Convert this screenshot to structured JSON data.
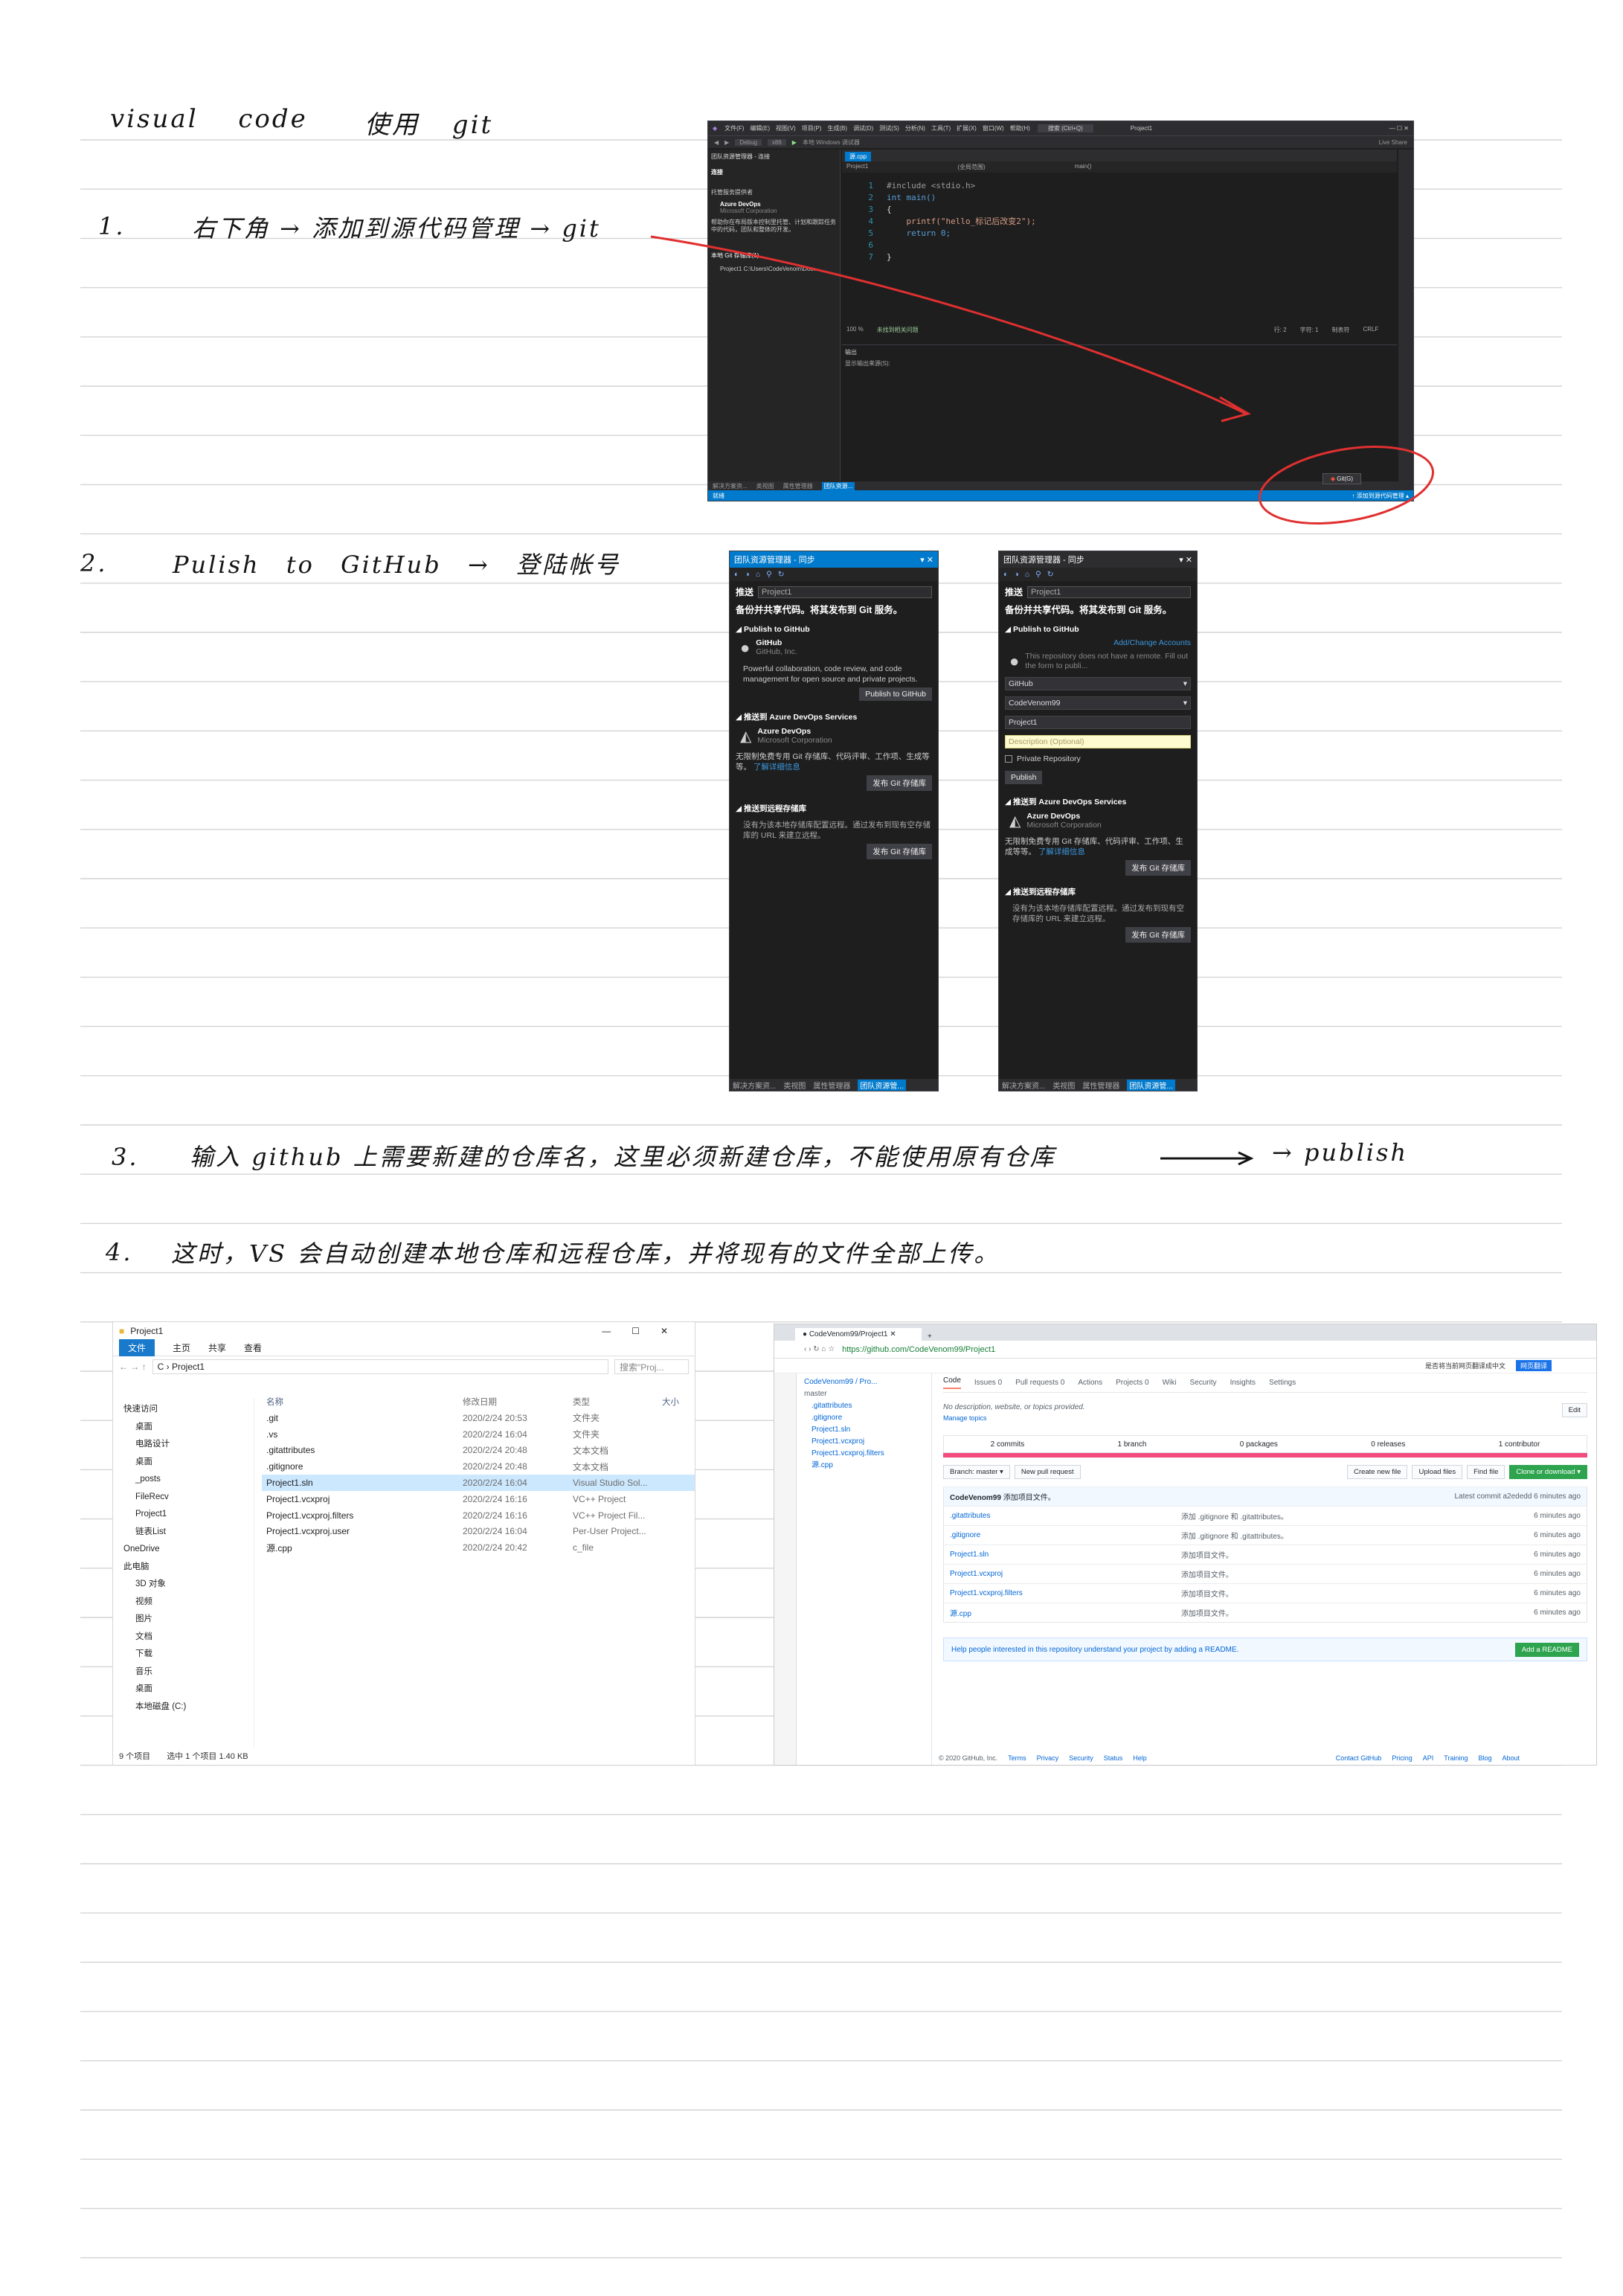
{
  "notes": {
    "title": {
      "left": "visual code",
      "right": "使用 git"
    },
    "step1": {
      "num": "1.",
      "text": "右下角 → 添加到源代码管理 → git"
    },
    "step2": {
      "num": "2.",
      "text": "Pulish to GitHub → 登陆帐号"
    },
    "step3": {
      "num": "3.",
      "text": "输入 github 上需要新建的仓库名，这里必须新建仓库，不能使用原有仓库",
      "arrow_target": "→ publish"
    },
    "step4": {
      "num": "4.",
      "text": "这时，VS 会自动创建本地仓库和远程仓库，并将现有的文件全部上传。"
    }
  },
  "vs": {
    "title": "Project1",
    "menu": [
      "文件(F)",
      "编辑(E)",
      "视图(V)",
      "项目(P)",
      "生成(B)",
      "调试(D)",
      "测试(S)",
      "分析(N)",
      "工具(T)",
      "扩展(X)",
      "窗口(W)",
      "帮助(H)"
    ],
    "search_placeholder": "搜索 (Ctrl+Q)",
    "config": "Debug",
    "platform": "x86",
    "debugger": "本地 Windows 调试器",
    "live_share": "Live Share",
    "left_title": "团队资源管理器 - 连接",
    "left_connect": "连接",
    "left_hosting": "托管服务提供者",
    "left_provider": "Azure DevOps",
    "left_provider_co": "Microsoft Corporation",
    "left_desc": "帮助你在布局版本控制里托管、计划和跟踪任务中的代码，团队和整体的开发。",
    "left_local_repos": "本地 Git 存储库(1)",
    "left_repo": "Project1  C:\\Users\\CodeVenom\\Doc...",
    "tab_file": "源.cpp",
    "breadcrumb": [
      "Project1",
      "(全局范围)",
      "main()"
    ],
    "code_lines": [
      "#include <stdio.h>",
      "int main()",
      "{",
      "    printf(\"hello_标记后改变2\");",
      "    return 0;",
      "",
      "}"
    ],
    "output_title": "输出",
    "output_source": "显示输出来源(S):",
    "zoom": "100 %",
    "no_issues": "未找到相关问题",
    "bottom_tabs": [
      "解决方案资...",
      "类视图",
      "属性管理器",
      "团队资源..."
    ],
    "status_left": "就绪",
    "status_popup": "Git(G)",
    "status_right": "添加到源代码管理",
    "cursor_pos": [
      "行: 2",
      "字符: 1",
      "制表符",
      "CRLF"
    ]
  },
  "team_a": {
    "header": "团队资源管理器 - 同步",
    "push_label": "推送",
    "project": "Project1",
    "heading": "备份并共享代码。将其发布到 Git 服务。",
    "sec_github": "Publish to GitHub",
    "gh_name": "GitHub",
    "gh_co": "GitHub, Inc.",
    "gh_desc": "Powerful collaboration, code review, and code management for open source and private projects.",
    "gh_button": "Publish to GitHub",
    "sec_azure": "推送到 Azure DevOps Services",
    "az_name": "Azure DevOps",
    "az_co": "Microsoft Corporation",
    "az_desc": "无限制免费专用 Git 存储库、代码评审、工作项、生成等等。",
    "az_link": "了解详细信息",
    "az_button": "发布 Git 存储库",
    "sec_remote": "推送到远程存储库",
    "remote_desc": "没有为该本地存储库配置远程。通过发布到现有空存储库的 URL 来建立远程。",
    "remote_button": "发布 Git 存储库",
    "foot": [
      "解决方案资...",
      "类视图",
      "属性管理器",
      "团队资源管..."
    ]
  },
  "team_b": {
    "header": "团队资源管理器 - 同步",
    "push_label": "推送",
    "project": "Project1",
    "heading": "备份并共享代码。将其发布到 Git 服务。",
    "sec_github": "Publish to GitHub",
    "add_accounts": "Add/Change Accounts",
    "info": "This repository does not have a remote. Fill out the form to publi...",
    "host": "GitHub",
    "account": "CodeVenom99",
    "repo_name": "Project1",
    "desc_placeholder": "Description (Optional)",
    "private_label": "Private Repository",
    "publish_button": "Publish",
    "sec_azure": "推送到 Azure DevOps Services",
    "az_name": "Azure DevOps",
    "az_co": "Microsoft Corporation",
    "az_desc": "无限制免费专用 Git 存储库、代码评审、工作项、生成等等。",
    "az_link": "了解详细信息",
    "az_button": "发布 Git 存储库",
    "sec_remote": "推送到远程存储库",
    "remote_desc": "没有为该本地存储库配置远程。通过发布到现有空存储库的 URL 来建立远程。",
    "remote_button": "发布 Git 存储库",
    "foot": [
      "解决方案资...",
      "类视图",
      "属性管理器",
      "团队资源管..."
    ]
  },
  "explorer": {
    "title": "Project1",
    "ribbon": [
      "文件",
      "主页",
      "共享",
      "查看"
    ],
    "path": "C › Project1",
    "search_placeholder": "搜索\"Proj...",
    "nav": [
      "快速访问",
      "桌面",
      "电路设计",
      "桌面",
      "_posts",
      "FileRecv",
      "Project1",
      "链表List",
      "OneDrive",
      "此电脑",
      "3D 对象",
      "视频",
      "图片",
      "文档",
      "下载",
      "音乐",
      "桌面",
      "本地磁盘 (C:)"
    ],
    "columns": [
      "名称",
      "修改日期",
      "类型",
      "大小"
    ],
    "rows": [
      {
        "name": ".git",
        "date": "2020/2/24 20:53",
        "type": "文件夹"
      },
      {
        "name": ".vs",
        "date": "2020/2/24 16:04",
        "type": "文件夹"
      },
      {
        "name": ".gitattributes",
        "date": "2020/2/24 20:48",
        "type": "文本文档"
      },
      {
        "name": ".gitignore",
        "date": "2020/2/24 20:48",
        "type": "文本文档"
      },
      {
        "name": "Project1.sln",
        "date": "2020/2/24 16:04",
        "type": "Visual Studio Sol..."
      },
      {
        "name": "Project1.vcxproj",
        "date": "2020/2/24 16:16",
        "type": "VC++ Project"
      },
      {
        "name": "Project1.vcxproj.filters",
        "date": "2020/2/24 16:16",
        "type": "VC++ Project Fil..."
      },
      {
        "name": "Project1.vcxproj.user",
        "date": "2020/2/24 16:04",
        "type": "Per-User Project..."
      },
      {
        "name": "源.cpp",
        "date": "2020/2/24 20:42",
        "type": "c_file"
      }
    ],
    "status_count": "9 个项目",
    "status_sel": "选中 1 个项目  1.40 KB"
  },
  "github": {
    "tab": "CodeVenom99/Project1",
    "url": "https://github.com/CodeVenom99/Project1",
    "tree_title": "CodeVenom99 / Pro...",
    "tree_branch": "master",
    "tree": [
      ".gitattributes",
      ".gitignore",
      "Project1.sln",
      "Project1.vcxproj",
      "Project1.vcxproj.filters",
      "源.cpp"
    ],
    "tabs": [
      "Code",
      "Issues 0",
      "Pull requests 0",
      "Actions",
      "Projects 0",
      "Wiki",
      "Security",
      "Insights",
      "Settings"
    ],
    "about": "No description, website, or topics provided.",
    "manage_topics": "Manage topics",
    "edit": "Edit",
    "stats": [
      "2 commits",
      "1 branch",
      "0 packages",
      "0 releases",
      "1 contributor"
    ],
    "branch_btn": "Branch: master ▾",
    "new_pr": "New pull request",
    "create_file": "Create new file",
    "upload": "Upload files",
    "find": "Find file",
    "clone": "Clone or download ▾",
    "commit_user": "CodeVenom99",
    "commit_msg": "添加项目文件。",
    "latest": "Latest commit a2ededd 6 minutes ago",
    "files": [
      {
        "name": ".gitattributes",
        "msg": "添加 .gitignore 和 .gitattributes。",
        "age": "6 minutes ago"
      },
      {
        "name": ".gitignore",
        "msg": "添加 .gitignore 和 .gitattributes。",
        "age": "6 minutes ago"
      },
      {
        "name": "Project1.sln",
        "msg": "添加项目文件。",
        "age": "6 minutes ago"
      },
      {
        "name": "Project1.vcxproj",
        "msg": "添加项目文件。",
        "age": "6 minutes ago"
      },
      {
        "name": "Project1.vcxproj.filters",
        "msg": "添加项目文件。",
        "age": "6 minutes ago"
      },
      {
        "name": "源.cpp",
        "msg": "添加项目文件。",
        "age": "6 minutes ago"
      }
    ],
    "readme_text": "Help people interested in this repository understand your project by adding a README.",
    "readme_btn": "Add a README",
    "translate": "是否将当前网页翻译成中文",
    "translate_btn": "网页翻译",
    "footer": [
      "© 2020 GitHub, Inc.",
      "Terms",
      "Privacy",
      "Security",
      "Status",
      "Help",
      "Contact GitHub",
      "Pricing",
      "API",
      "Training",
      "Blog",
      "About"
    ]
  }
}
